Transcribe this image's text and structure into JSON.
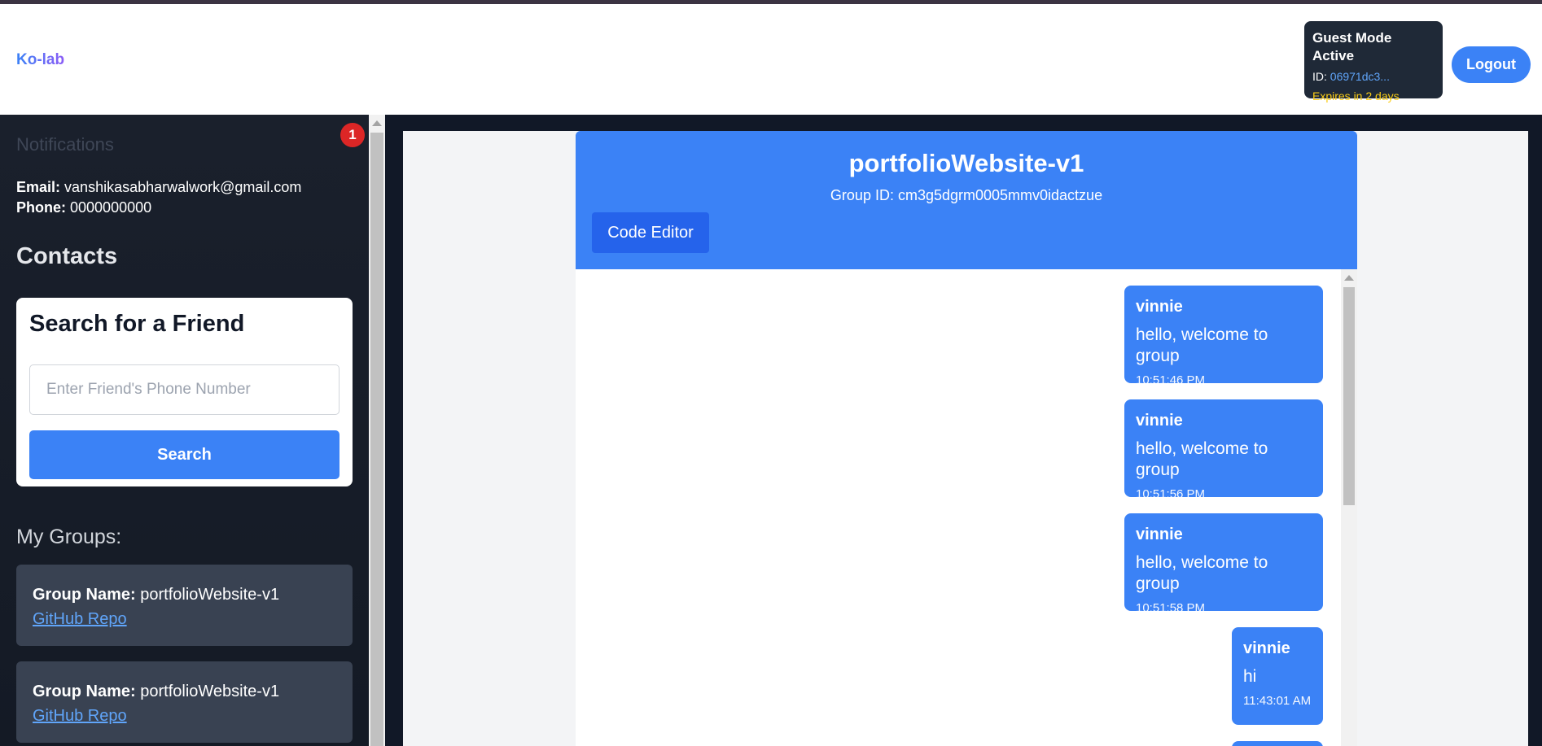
{
  "app": {
    "logo": "Ko-lab"
  },
  "guest": {
    "title": "Guest Mode Active",
    "id_label": "ID:",
    "id_value": "06971dc3...",
    "expires": "Expires in 2 days"
  },
  "header": {
    "logout_label": "Logout"
  },
  "sidebar": {
    "notifications_label": "Notifications",
    "notification_count": "1",
    "email_label": "Email:",
    "email_value": "vanshikasabharwalwork@gmail.com",
    "phone_label": "Phone:",
    "phone_value": "0000000000",
    "contacts_heading": "Contacts",
    "search_card": {
      "title": "Search for a Friend",
      "placeholder": "Enter Friend's Phone Number",
      "button_label": "Search"
    },
    "groups_heading": "My Groups:",
    "groups": [
      {
        "name_label": "Group Name:",
        "name": "portfolioWebsite-v1",
        "link_label": "GitHub Repo"
      },
      {
        "name_label": "Group Name:",
        "name": "portfolioWebsite-v1",
        "link_label": "GitHub Repo"
      }
    ]
  },
  "chat": {
    "group_name": "portfolioWebsite-v1",
    "group_id": "Group ID: cm3g5dgrm0005mmv0idactzue",
    "code_editor_label": "Code Editor",
    "messages": [
      {
        "user": "vinnie",
        "text": "hello, welcome to group",
        "time": "10:51:46 PM"
      },
      {
        "user": "vinnie",
        "text": "hello, welcome to group",
        "time": "10:51:56 PM"
      },
      {
        "user": "vinnie",
        "text": "hello, welcome to group",
        "time": "10:51:58 PM"
      },
      {
        "user": "vinnie",
        "text": "hi",
        "time": "11:43:01 AM"
      }
    ]
  },
  "colors": {
    "accent": "#3b82f6",
    "sidebar_bg": "#1a202c",
    "badge": "#dc2626",
    "expires": "#facc15"
  }
}
